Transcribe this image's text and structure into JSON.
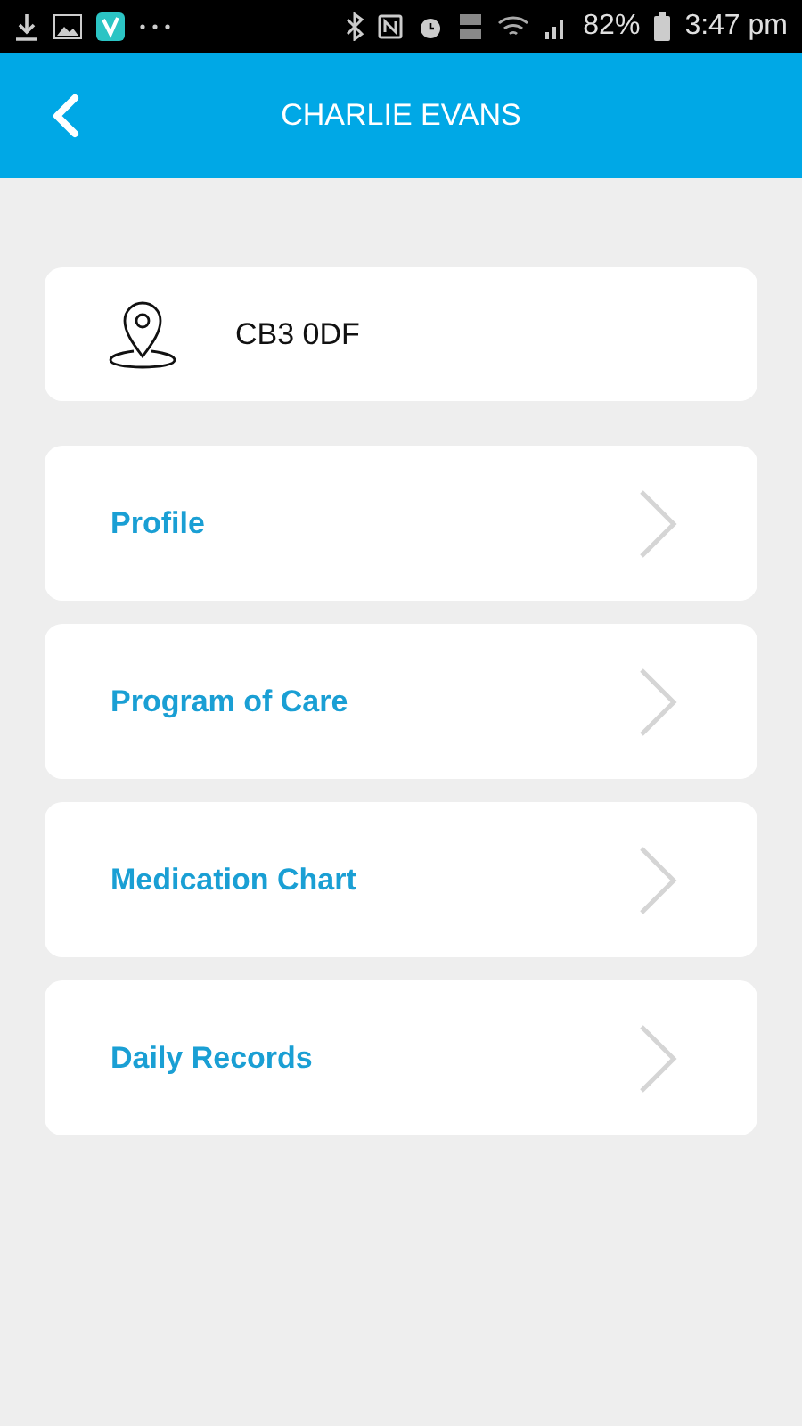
{
  "status_bar": {
    "battery": "82%",
    "time": "3:47 pm"
  },
  "header": {
    "title": "CHARLIE EVANS"
  },
  "address": {
    "postcode": "CB3 0DF"
  },
  "menu": [
    {
      "label": "Profile"
    },
    {
      "label": "Program of Care"
    },
    {
      "label": "Medication Chart"
    },
    {
      "label": "Daily Records"
    }
  ]
}
